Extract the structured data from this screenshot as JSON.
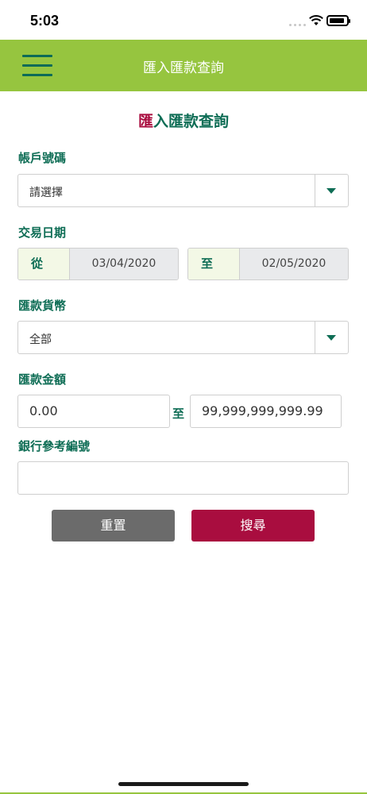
{
  "status_bar": {
    "time": "5:03"
  },
  "header": {
    "title": "匯入匯款查詢"
  },
  "page": {
    "title_first": "匯",
    "title_rest": "入匯款查詢"
  },
  "account": {
    "label": "帳戶號碼",
    "value": "請選擇"
  },
  "date": {
    "label": "交易日期",
    "from_prefix": "從",
    "from_value": "03/04/2020",
    "to_prefix": "至",
    "to_value": "02/05/2020"
  },
  "currency": {
    "label": "匯款貨幣",
    "value": "全部"
  },
  "amount": {
    "label": "匯款金額",
    "min_value": "0.00",
    "separator": "至",
    "max_value": "99,999,999,999.99"
  },
  "reference": {
    "label": "銀行參考編號",
    "value": ""
  },
  "buttons": {
    "reset": "重置",
    "search": "搜尋"
  },
  "colors": {
    "header_bg": "#96c53f",
    "primary_green": "#0e6d55",
    "accent_red": "#a90d3f",
    "reset_gray": "#6b6b6b"
  }
}
